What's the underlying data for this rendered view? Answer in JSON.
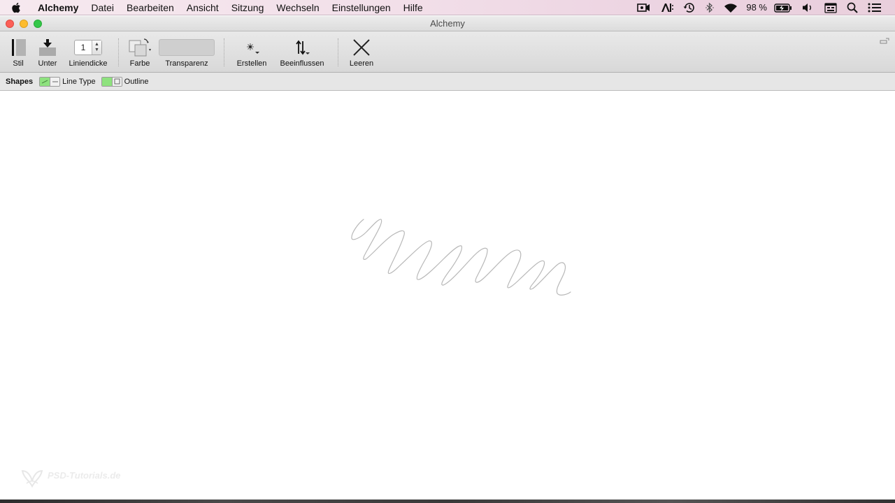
{
  "menubar": {
    "app_name": "Alchemy",
    "items": [
      "Datei",
      "Bearbeiten",
      "Ansicht",
      "Sitzung",
      "Wechseln",
      "Einstellungen",
      "Hilfe"
    ],
    "battery_text": "98 %",
    "status_icons": [
      "camera-icon",
      "font-icon",
      "time-machine-icon",
      "bluetooth-icon",
      "wifi-icon",
      "battery-icon",
      "volume-icon",
      "input-source-icon",
      "spotlight-icon",
      "notification-center-icon"
    ]
  },
  "window": {
    "title": "Alchemy"
  },
  "toolbar": {
    "stil_label": "Stil",
    "unter_label": "Unter",
    "liniendicke_label": "Liniendicke",
    "liniendicke_value": "1",
    "farbe_label": "Farbe",
    "transparenz_label": "Transparenz",
    "erstellen_label": "Erstellen",
    "beeinflussen_label": "Beeinflussen",
    "leeren_label": "Leeren"
  },
  "shapesbar": {
    "title": "Shapes",
    "line_type_label": "Line Type",
    "outline_label": "Outline"
  },
  "watermark": {
    "text": "PSD-Tutorials.de"
  },
  "colors": {
    "toggle_active": "#8ee27e",
    "stroke": "#b8b8b8"
  }
}
